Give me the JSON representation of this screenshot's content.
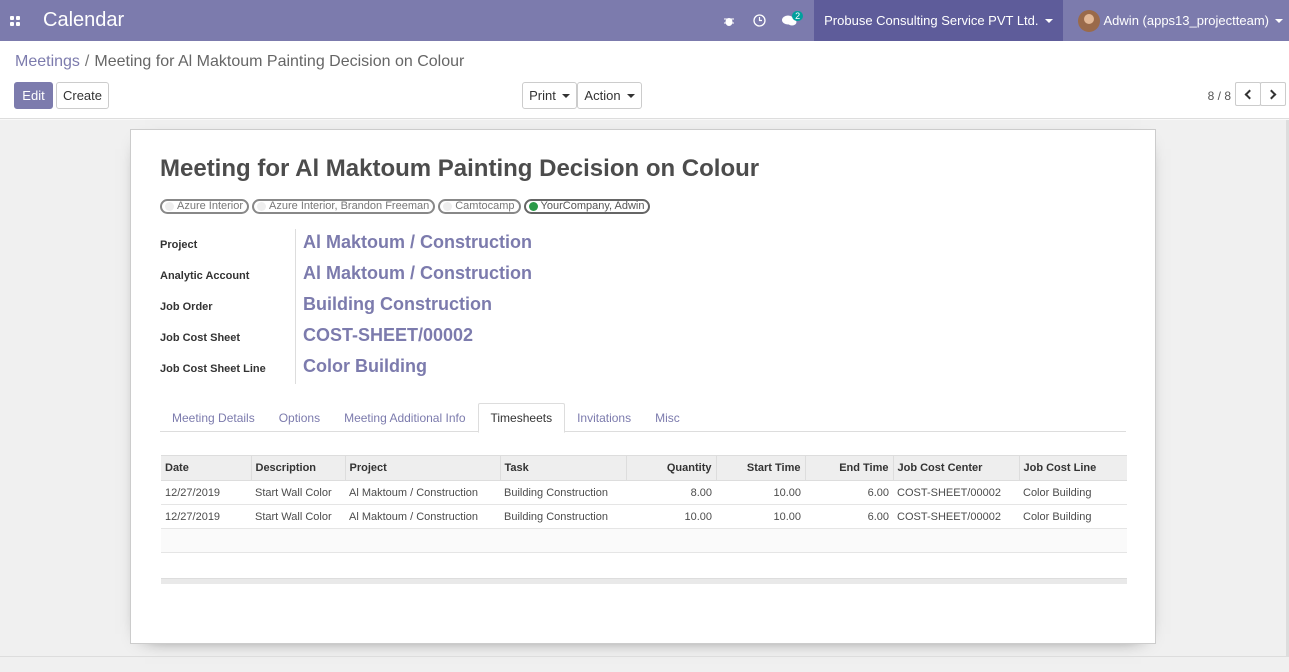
{
  "app": {
    "title": "Calendar"
  },
  "navbar": {
    "activity_badge": "2",
    "company": "Probuse Consulting Service PVT Ltd.",
    "user": "Adwin (apps13_projectteam)"
  },
  "breadcrumb": {
    "parent": "Meetings",
    "separator": "/",
    "current": "Meeting for Al Maktoum Painting Decision on Colour"
  },
  "buttons": {
    "edit": "Edit",
    "create": "Create",
    "print": "Print",
    "action": "Action"
  },
  "pager": {
    "value": "8 / 8"
  },
  "record": {
    "title": "Meeting for Al Maktoum Painting Decision on Colour",
    "attendees": [
      "Azure Interior",
      "Azure Interior, Brandon Freeman",
      "Camtocamp",
      "YourCompany, Adwin"
    ],
    "fields": [
      {
        "label": "Project",
        "value": "Al Maktoum / Construction"
      },
      {
        "label": "Analytic Account",
        "value": "Al Maktoum / Construction"
      },
      {
        "label": "Job Order",
        "value": "Building Construction"
      },
      {
        "label": "Job Cost Sheet",
        "value": "COST-SHEET/00002"
      },
      {
        "label": "Job Cost Sheet Line",
        "value": "Color Building"
      }
    ]
  },
  "tabs": [
    "Meeting Details",
    "Options",
    "Meeting Additional Info",
    "Timesheets",
    "Invitations",
    "Misc"
  ],
  "active_tab": "Timesheets",
  "timesheets": {
    "columns": [
      "Date",
      "Description",
      "Project",
      "Task",
      "Quantity",
      "Start Time",
      "End Time",
      "Job Cost Center",
      "Job Cost Line"
    ],
    "rows": [
      [
        "12/27/2019",
        "Start Wall Color",
        "Al Maktoum / Construction",
        "Building Construction",
        "8.00",
        "10.00",
        "6.00",
        "COST-SHEET/00002",
        "Color Building"
      ],
      [
        "12/27/2019",
        "Start Wall Color",
        "Al Maktoum / Construction",
        "Building Construction",
        "10.00",
        "10.00",
        "6.00",
        "COST-SHEET/00002",
        "Color Building"
      ]
    ]
  },
  "colors": {
    "brand": "#7c7bad",
    "company_bg": "#5e5c9a",
    "badge": "#00a09d"
  }
}
